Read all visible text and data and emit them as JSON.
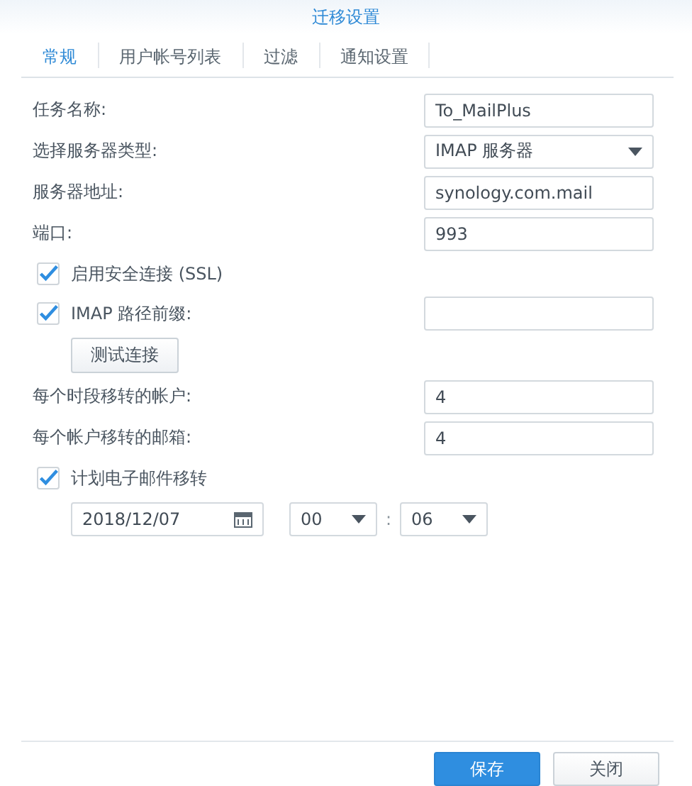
{
  "window": {
    "title": "迁移设置"
  },
  "tabs": [
    {
      "label": "常规",
      "selected": true
    },
    {
      "label": "用户帐号列表",
      "selected": false
    },
    {
      "label": "过滤",
      "selected": false
    },
    {
      "label": "通知设置",
      "selected": false
    }
  ],
  "form": [
    {
      "kind": "text",
      "label": "任务名称:",
      "value": "To_MailPlus"
    },
    {
      "kind": "select",
      "label": "选择服务器类型:",
      "value": "IMAP 服务器"
    },
    {
      "kind": "text",
      "label": "服务器地址:",
      "value": "synology.com.mail"
    },
    {
      "kind": "text",
      "label": "端口:",
      "value": "993"
    },
    {
      "kind": "check",
      "label": "启用安全连接 (SSL)",
      "checked": true
    },
    {
      "kind": "check-field",
      "label": "IMAP 路径前缀:",
      "checked": true
    },
    {
      "kind": "button",
      "label": "测试连接"
    },
    {
      "kind": "text",
      "label": "每个时段移转的帐户:",
      "value": "4"
    },
    {
      "kind": "text",
      "label": "每个帐户移转的邮箱:",
      "value": "4"
    },
    {
      "kind": "check",
      "label": "计划电子邮件移转",
      "checked": true
    },
    {
      "kind": "schedule",
      "date": "2018/12/07",
      "hour": "00",
      "separator": ":",
      "minute": "06"
    }
  ],
  "buttons": [
    {
      "label": "保存",
      "kind": "primary"
    },
    {
      "label": "关闭",
      "kind": "default"
    }
  ]
}
